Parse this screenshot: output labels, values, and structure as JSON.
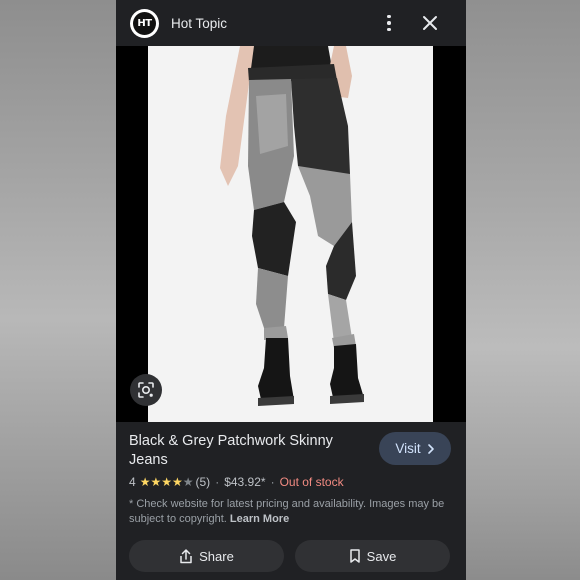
{
  "header": {
    "logo_text": "HT",
    "site_name": "Hot Topic"
  },
  "product": {
    "title": "Black & Grey Patchwork Skinny Jeans",
    "rating": "4",
    "stars_filled": 4,
    "stars_total": 5,
    "review_count": "(5)",
    "separator": "·",
    "price": "$43.92*",
    "stock_status": "Out of stock"
  },
  "visit_button": {
    "label": "Visit"
  },
  "disclaimer": {
    "text": "* Check website for latest pricing and availability. Images may be subject to copyright.",
    "link": "Learn More"
  },
  "actions": {
    "share_label": "Share",
    "save_label": "Save"
  },
  "colors": {
    "panel_bg": "#202124",
    "star_filled": "#fdd663",
    "star_empty": "#80868b",
    "out_of_stock": "#f28b82",
    "visit_bg": "#394457"
  },
  "icons": [
    "hot-topic-logo",
    "more-vert-icon",
    "close-icon",
    "lens-search-icon",
    "chevron-right-icon",
    "share-icon",
    "bookmark-icon",
    "star-icon"
  ]
}
